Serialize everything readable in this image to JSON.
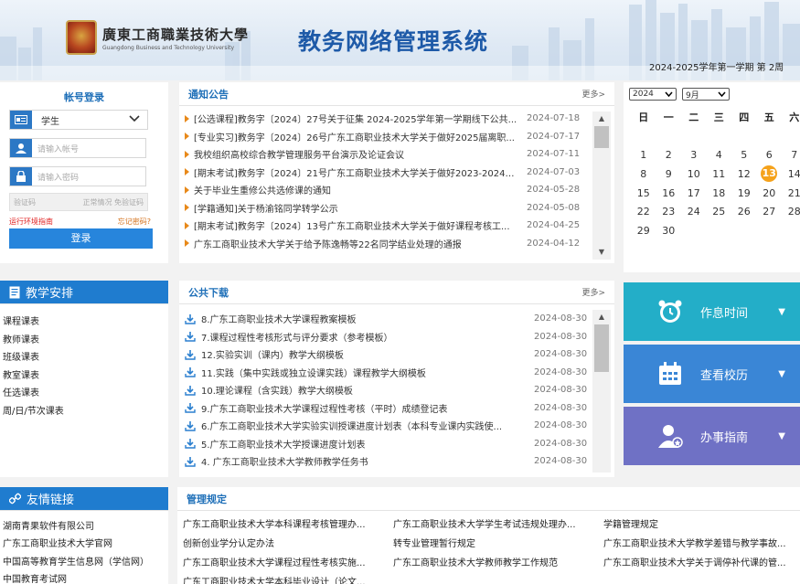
{
  "header": {
    "school_cn": "廣東工商職業技術大學",
    "school_en": "Guangdong Business and Technology University",
    "system_title": "教务网络管理系统",
    "term": "2024-2025学年第一学期  第 2周"
  },
  "login": {
    "title": "帐号登录",
    "role": "学生",
    "account_placeholder": "请输入帐号",
    "password_placeholder": "请输入密码",
    "captcha_placeholder": "验证码",
    "captcha_status": "正常情况 免验证码",
    "env_link": "运行环境指南",
    "forgot_link": "忘记密码?",
    "submit": "登录"
  },
  "notice": {
    "title": "通知公告",
    "more": "更多>",
    "items": [
      {
        "text": "[公选课程]教务字〔2024〕27号关于征集 2024-2025学年第一学期线下公共...",
        "date": "2024-07-18"
      },
      {
        "text": "[专业实习]教务字〔2024〕26号广东工商职业技术大学关于做好2025届离职...",
        "date": "2024-07-17"
      },
      {
        "text": "我校组织高校综合教学管理服务平台演示及论证会议",
        "date": "2024-07-11"
      },
      {
        "text": "[期末考试]教务字〔2024〕21号广东工商职业技术大学关于做好2023-2024学...",
        "date": "2024-07-03"
      },
      {
        "text": "关于毕业生重修公共选修课的通知",
        "date": "2024-05-28"
      },
      {
        "text": "[学籍通知]关于杨渝铭同学转学公示",
        "date": "2024-05-08"
      },
      {
        "text": "[期末考试]教务字〔2024〕13号广东工商职业技术大学关于做好课程考核工...",
        "date": "2024-04-25"
      },
      {
        "text": "广东工商职业技术大学关于给予陈逸畅等22名同学结业处理的通报",
        "date": "2024-04-12"
      }
    ]
  },
  "calendar": {
    "year": "2024",
    "month": "9月",
    "weekdays": [
      "日",
      "一",
      "二",
      "三",
      "四",
      "五",
      "六"
    ],
    "weeks": [
      [
        "",
        "",
        "",
        "",
        "",
        "",
        ""
      ],
      [
        "1",
        "2",
        "3",
        "4",
        "5",
        "6",
        "7"
      ],
      [
        "8",
        "9",
        "10",
        "11",
        "12",
        "13",
        "14"
      ],
      [
        "15",
        "16",
        "17",
        "18",
        "19",
        "20",
        "21"
      ],
      [
        "22",
        "23",
        "24",
        "25",
        "26",
        "27",
        "28"
      ],
      [
        "29",
        "30",
        "",
        "",
        "",
        "",
        ""
      ]
    ],
    "today": "13",
    "today_color": "#f5a21b"
  },
  "teach": {
    "title": "教学安排",
    "items": [
      "课程课表",
      "教师课表",
      "班级课表",
      "教室课表",
      "任选课表",
      "周/日/节次课表"
    ]
  },
  "download": {
    "title": "公共下载",
    "more": "更多>",
    "items": [
      {
        "text": "8.广东工商职业技术大学课程教案模板",
        "date": "2024-08-30"
      },
      {
        "text": "7.课程过程性考核形式与评分要求（参考模板）",
        "date": "2024-08-30"
      },
      {
        "text": "12.实验实训（课内）教学大纲模板",
        "date": "2024-08-30"
      },
      {
        "text": "11.实践（集中实践或独立设课实践）课程教学大纲模板",
        "date": "2024-08-30"
      },
      {
        "text": "10.理论课程（含实践）教学大纲模板",
        "date": "2024-08-30"
      },
      {
        "text": "9.广东工商职业技术大学课程过程性考核（平时）成绩登记表",
        "date": "2024-08-30"
      },
      {
        "text": "6.广东工商职业技术大学实验实训授课进度计划表（本科专业课内实践使...",
        "date": "2024-08-30"
      },
      {
        "text": "5.广东工商职业技术大学授课进度计划表",
        "date": "2024-08-30"
      },
      {
        "text": "4. 广东工商职业技术大学教师教学任务书",
        "date": "2024-08-30"
      }
    ]
  },
  "tiles": [
    {
      "label": "作息时间",
      "icon": "alarm-clock-icon",
      "color": "#23aec8"
    },
    {
      "label": "查看校历",
      "icon": "calendar-icon",
      "color": "#3a86d6"
    },
    {
      "label": "办事指南",
      "icon": "user-guide-icon",
      "color": "#6f71c5"
    }
  ],
  "friends": {
    "title": "友情链接",
    "items": [
      "湖南青果软件有限公司",
      "广东工商职业技术大学官网",
      "中国高等教育学生信息网（学信网）",
      "中国教育考试网"
    ]
  },
  "rules": {
    "title": "管理规定",
    "items": [
      "广东工商职业技术大学本科课程考核管理办...",
      "广东工商职业技术大学学生考试违规处理办...",
      "学籍管理规定",
      "创新创业学分认定办法",
      "转专业管理暂行规定",
      "广东工商职业技术大学教学差错与教学事故...",
      "广东工商职业技术大学课程过程性考核实施...",
      "广东工商职业技术大学教师教学工作规范",
      "广东工商职业技术大学关于调停补代课的管...",
      "广东工商职业技术大学本科毕业设计（论文..."
    ]
  }
}
